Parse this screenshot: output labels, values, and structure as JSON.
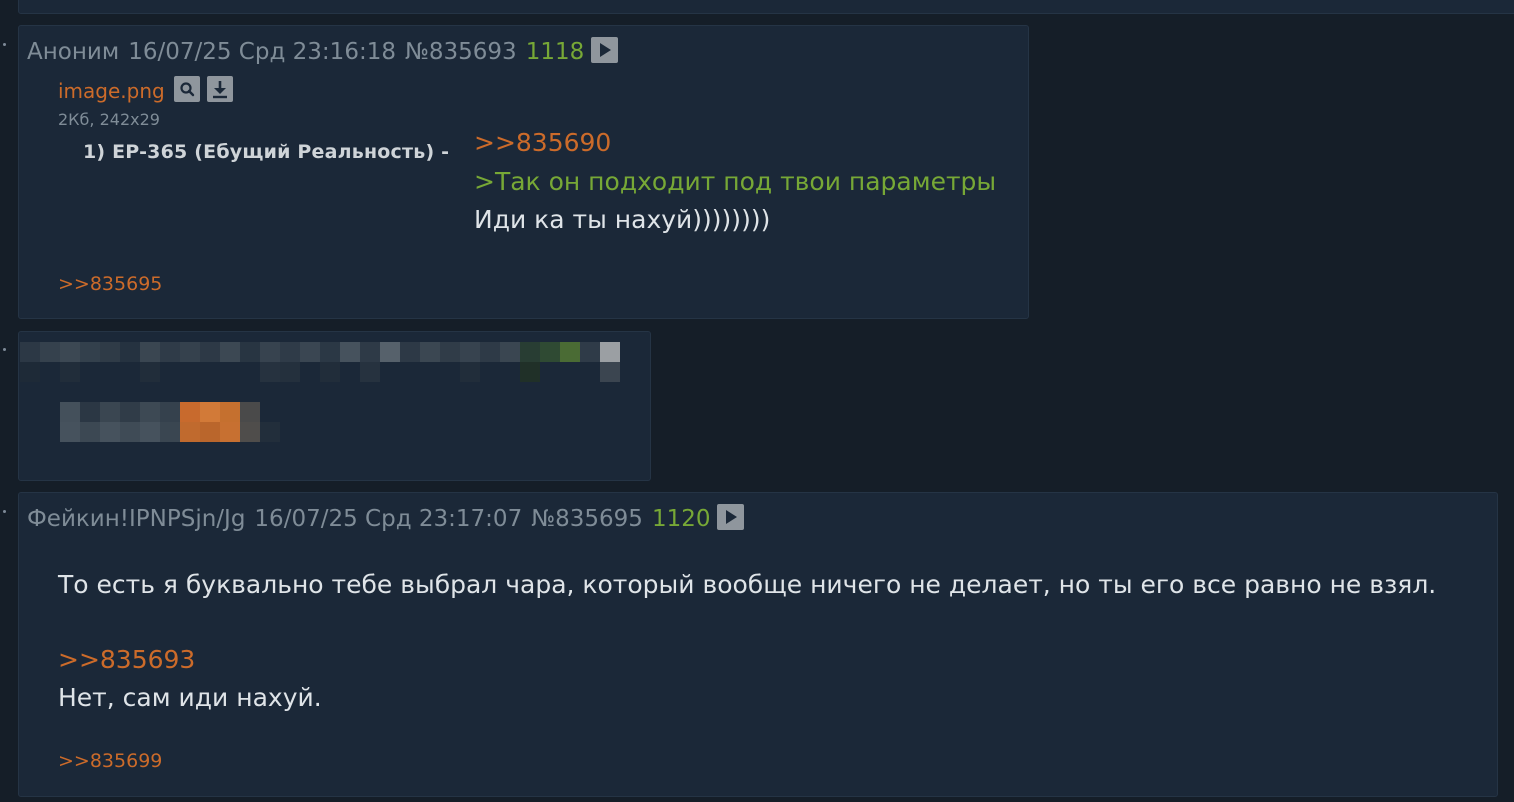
{
  "posts": [
    {
      "name": "Аноним",
      "date": "16/07/25 Срд 23:16:18",
      "number": "№835693",
      "count": "1118",
      "file": {
        "name": "image.png",
        "meta": "2Кб, 242x29",
        "thumb_text": "1) EP-365 (Ебущий Реальность) -"
      },
      "reply_to": ">>835690",
      "quote": ">Так он подходит под твои параметры",
      "text": "Иди ка ты нахуй))))))))",
      "backlink": ">>835695"
    },
    {
      "name": "Фейкин!IPNPSjn/Jg",
      "date": "16/07/25 Срд 23:17:07",
      "number": "№835695",
      "count": "1120",
      "text1": "То есть я буквально тебе выбрал чара, который вообще ничего не делает, но ты его все равно не взял.",
      "reply_to": ">>835693",
      "text2": "Нет, сам иди нахуй.",
      "backlink": ">>835699"
    }
  ],
  "colors": {
    "background": "#151e28",
    "post_bg": "#1b2838",
    "link": "#cc6b2a",
    "quote": "#77a836",
    "meta": "#7f8c97",
    "text": "#dfe4e8"
  },
  "icons": [
    "play-icon",
    "magnifier-icon",
    "download-icon"
  ]
}
